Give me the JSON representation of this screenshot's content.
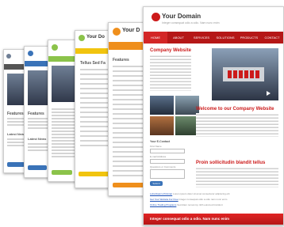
{
  "brand": {
    "name": "Your Domain",
    "tagline": "Integer consequat odio a odio. Nam nunc enim"
  },
  "nav": [
    "HOME",
    "ABOUT",
    "SERVICES",
    "SOLUTIONS",
    "PRODUCTS",
    "CONTACT"
  ],
  "main": {
    "company_title": "Company Website",
    "welcome_title": "Welcome to our Company Website",
    "proin_title": "Proin sollicitudin blandit tellus",
    "footer_text": "Integer consequat odio a odio. Nam nunc enim"
  },
  "sidebar": {
    "form_title": "Your E-Contact",
    "first_name": "First Name",
    "email": "E-mail Address",
    "message": "Questions or Comments",
    "submit": "Submit"
  },
  "links": [
    {
      "label": "Lobortisarcu Pulvinar",
      "rest": "Lorem ipsum dolor sit amet consectetur adipiscing elit"
    },
    {
      "label": "Get Your Website For Free",
      "rest": "Integer consequat odio a odio nam nunc enim"
    },
    {
      "label": "Online Trading Programs",
      "rest": "Sed diam nonummy nibh euismod tincidunt"
    }
  ],
  "previews": [
    {
      "brand": "",
      "heading": "Features",
      "accent": "#3a3a3a"
    },
    {
      "brand": "",
      "heading": "Features",
      "accent": "#3a73b8"
    },
    {
      "brand": "",
      "heading": "Latest News",
      "accent": "#8bc34a"
    },
    {
      "brand": "Your Do",
      "heading": "Tellus Sed Fa",
      "accent": "#f1c40f"
    },
    {
      "brand": "Your D",
      "heading": "Features",
      "accent": "#ef8f1c"
    },
    {
      "brand": "",
      "heading": "Latest News",
      "accent": "#333333"
    }
  ],
  "colors": {
    "primary": "#cc1a1a",
    "nav": "#b51717"
  }
}
